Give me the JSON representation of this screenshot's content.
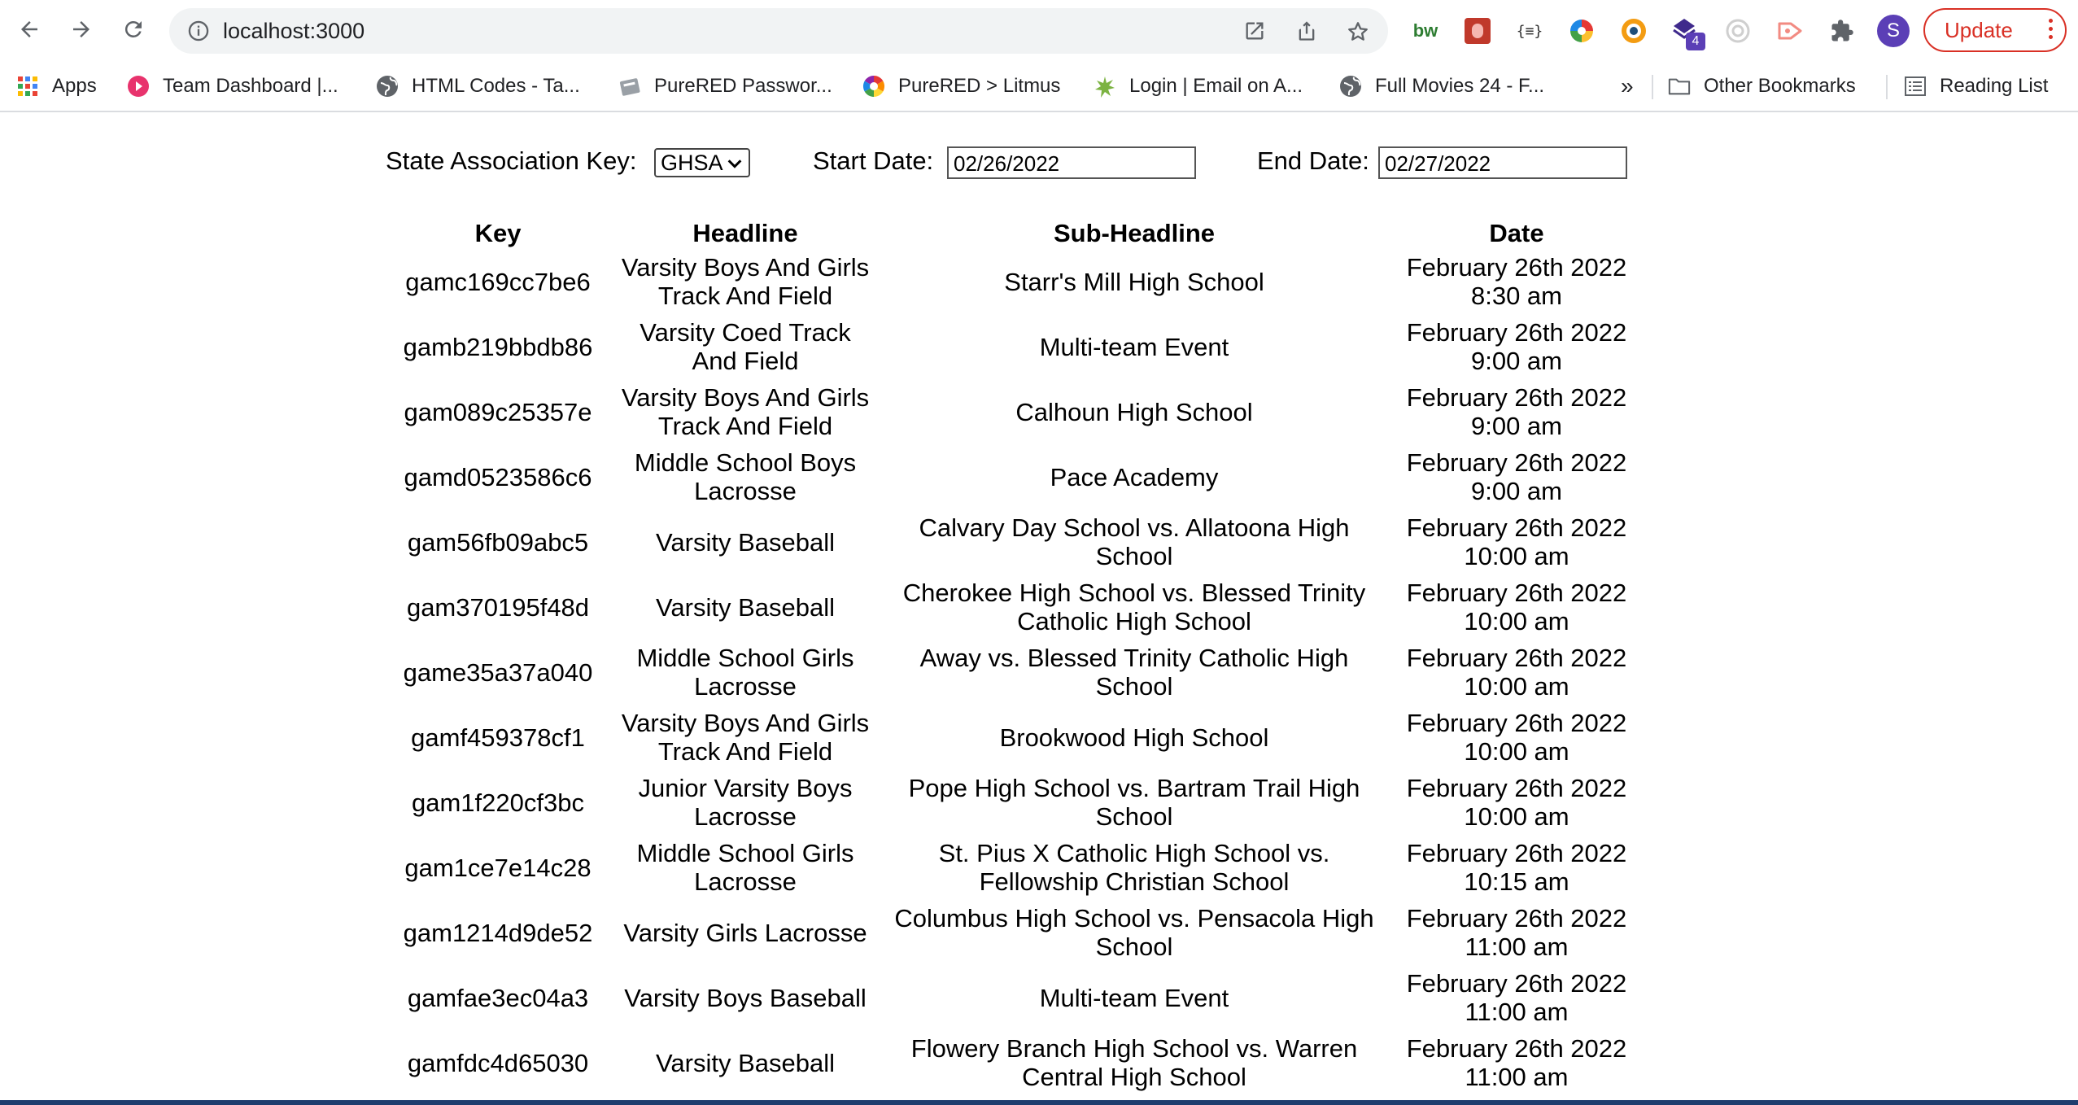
{
  "browser": {
    "url": "localhost:3000",
    "update_label": "Update",
    "avatar_initial": "S",
    "extension_badge": "4",
    "extension_text": "{≡}",
    "bookmarks": [
      {
        "label": "Apps",
        "icon": "apps-grid-icon"
      },
      {
        "label": "Team Dashboard |...",
        "icon": "red-play-icon"
      },
      {
        "label": "HTML Codes - Ta...",
        "icon": "globe-icon"
      },
      {
        "label": "PureRED Passwor...",
        "icon": "password-icon"
      },
      {
        "label": "PureRED > Litmus",
        "icon": "litmus-icon"
      },
      {
        "label": "Login | Email on A...",
        "icon": "splat-icon"
      },
      {
        "label": "Full Movies 24 - F...",
        "icon": "globe-icon"
      }
    ],
    "overflow": "»",
    "other_bookmarks": "Other Bookmarks",
    "reading_list": "Reading List"
  },
  "filters": {
    "state_label": "State Association Key:",
    "state_value": "GHSA",
    "start_label": "Start Date:",
    "start_value": "02/26/2022",
    "end_label": "End Date:",
    "end_value": "02/27/2022"
  },
  "table": {
    "columns": [
      "Key",
      "Headline",
      "Sub-Headline",
      "Date"
    ],
    "rows": [
      {
        "key": "gamc169cc7be6",
        "headline": "Varsity Boys And Girls Track And Field",
        "sub": "Starr's Mill High School",
        "date": "February 26th 2022",
        "time": "8:30 am"
      },
      {
        "key": "gamb219bbdb86",
        "headline": "Varsity Coed Track And Field",
        "sub": "Multi-team Event",
        "date": "February 26th 2022",
        "time": "9:00 am"
      },
      {
        "key": "gam089c25357e",
        "headline": "Varsity Boys And Girls Track And Field",
        "sub": "Calhoun High School",
        "date": "February 26th 2022",
        "time": "9:00 am"
      },
      {
        "key": "gamd0523586c6",
        "headline": "Middle School Boys Lacrosse",
        "sub": "Pace Academy",
        "date": "February 26th 2022",
        "time": "9:00 am"
      },
      {
        "key": "gam56fb09abc5",
        "headline": "Varsity Baseball",
        "sub": "Calvary Day School vs. Allatoona High School",
        "date": "February 26th 2022",
        "time": "10:00 am"
      },
      {
        "key": "gam370195f48d",
        "headline": "Varsity Baseball",
        "sub": "Cherokee High School vs. Blessed Trinity Catholic High School",
        "date": "February 26th 2022",
        "time": "10:00 am"
      },
      {
        "key": "game35a37a040",
        "headline": "Middle School Girls Lacrosse",
        "sub": "Away vs. Blessed Trinity Catholic High School",
        "date": "February 26th 2022",
        "time": "10:00 am"
      },
      {
        "key": "gamf459378cf1",
        "headline": "Varsity Boys And Girls Track And Field",
        "sub": "Brookwood High School",
        "date": "February 26th 2022",
        "time": "10:00 am"
      },
      {
        "key": "gam1f220cf3bc",
        "headline": "Junior Varsity Boys Lacrosse",
        "sub": "Pope High School vs. Bartram Trail High School",
        "date": "February 26th 2022",
        "time": "10:00 am"
      },
      {
        "key": "gam1ce7e14c28",
        "headline": "Middle School Girls Lacrosse",
        "sub": "St. Pius X Catholic High School vs. Fellowship Christian School",
        "date": "February 26th 2022",
        "time": "10:15 am"
      },
      {
        "key": "gam1214d9de52",
        "headline": "Varsity Girls Lacrosse",
        "sub": "Columbus High School vs. Pensacola High School",
        "date": "February 26th 2022",
        "time": "11:00 am"
      },
      {
        "key": "gamfae3ec04a3",
        "headline": "Varsity Boys Baseball",
        "sub": "Multi-team Event",
        "date": "February 26th 2022",
        "time": "11:00 am"
      },
      {
        "key": "gamfdc4d65030",
        "headline": "Varsity Baseball",
        "sub": "Flowery Branch High School vs. Warren Central High School",
        "date": "February 26th 2022",
        "time": "11:00 am"
      }
    ]
  },
  "colors": {
    "update_red": "#d93025",
    "avatar": "#5b3fb6",
    "badge": "#5b3fb6"
  }
}
